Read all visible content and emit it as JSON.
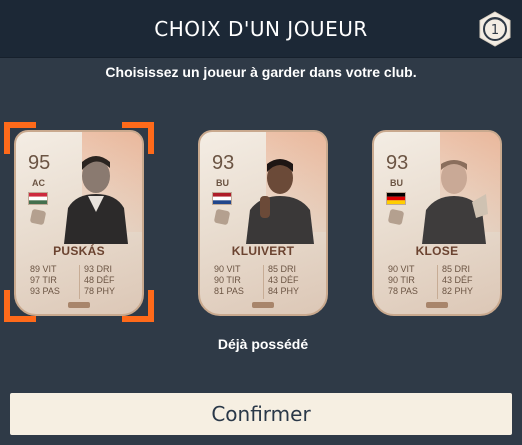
{
  "header": {
    "title": "CHOIX D'UN JOUEUR",
    "round_badge": "1"
  },
  "subtitle": "Choisissez un joueur à garder dans votre club.",
  "cards": [
    {
      "rating": "95",
      "position": "AC",
      "name": "PUSKÁS",
      "flag": "hungary",
      "flag_colors": [
        "#cd2a3e",
        "#ffffff",
        "#436f4d"
      ],
      "selected": true,
      "stats": [
        "89 VIT",
        "93 DRI",
        "97 TIR",
        "48 DÉF",
        "93 PAS",
        "78 PHY"
      ]
    },
    {
      "rating": "93",
      "position": "BU",
      "name": "KLUIVERT",
      "flag": "netherlands",
      "flag_colors": [
        "#ae1c28",
        "#ffffff",
        "#21468b"
      ],
      "selected": false,
      "stats": [
        "90 VIT",
        "85 DRI",
        "90 TIR",
        "43 DÉF",
        "81 PAS",
        "84 PHY"
      ]
    },
    {
      "rating": "93",
      "position": "BU",
      "name": "KLOSE",
      "flag": "germany",
      "flag_colors": [
        "#000000",
        "#dd0000",
        "#ffce00"
      ],
      "selected": false,
      "stats": [
        "90 VIT",
        "85 DRI",
        "90 TIR",
        "43 DÉF",
        "78 PAS",
        "82 PHY"
      ]
    }
  ],
  "owned_label": "Déjà possédé",
  "confirm_label": "Confirmer",
  "colors": {
    "background": "#2f3a47",
    "header": "#1c2836",
    "selection": "#ff6a1a",
    "confirm_bg": "#f6efe2"
  }
}
